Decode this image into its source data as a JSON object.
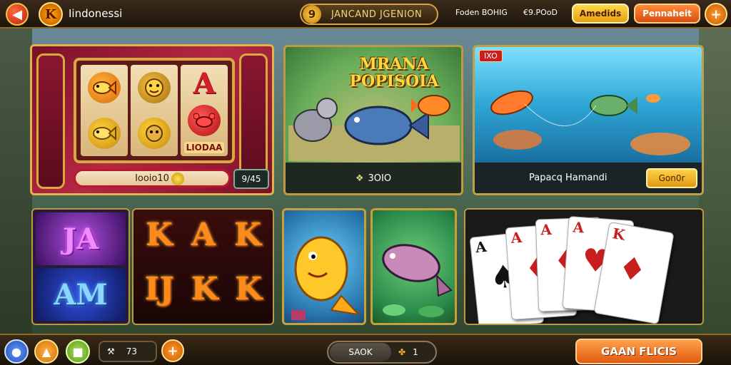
{
  "header": {
    "back_icon": "back-arrow-icon",
    "logo_letter": "K",
    "app_title": "Iindonessi",
    "banner_number": "9",
    "banner_text": "JANCAND JGENION",
    "stat1": "Foden BOHIG",
    "stat2": "€9.POoD",
    "btn_yellow": "Amedids",
    "btn_orange": "Pennaheit",
    "plus_icon": "+"
  },
  "slot_game": {
    "reel_words": "LIODAA",
    "bar_text": "Iooio10",
    "mini_text": "9/45"
  },
  "fish_game": {
    "title": "MRANA POPISOIA",
    "footer_icon": "❖",
    "footer_text": "3OIO"
  },
  "ocean_game": {
    "tag": "IXO",
    "name": "Papacq Hamandi",
    "button": "Gon0r"
  },
  "neon_game": {
    "top": "JA",
    "bottom": "AM"
  },
  "letters_game": {
    "row1": [
      "K",
      "A",
      "K"
    ],
    "row2": [
      "IJ",
      "K",
      "K"
    ]
  },
  "cards": [
    {
      "rank": "A",
      "suit": "♠",
      "color": "#111"
    },
    {
      "rank": "A",
      "suit": "♦",
      "color": "#c81e1e"
    },
    {
      "rank": "A",
      "suit": "♦",
      "color": "#c81e1e"
    },
    {
      "rank": "A",
      "suit": "♥",
      "color": "#c81e1e"
    },
    {
      "rank": "K",
      "suit": "♦",
      "color": "#c81e1e"
    }
  ],
  "footer": {
    "counter_icon": "⚒",
    "counter_value": "73",
    "plus_icon": "+",
    "mid_label": "SAOK",
    "mid_icon": "✤",
    "mid_value": "1",
    "cta": "GAAN FLICIS"
  }
}
